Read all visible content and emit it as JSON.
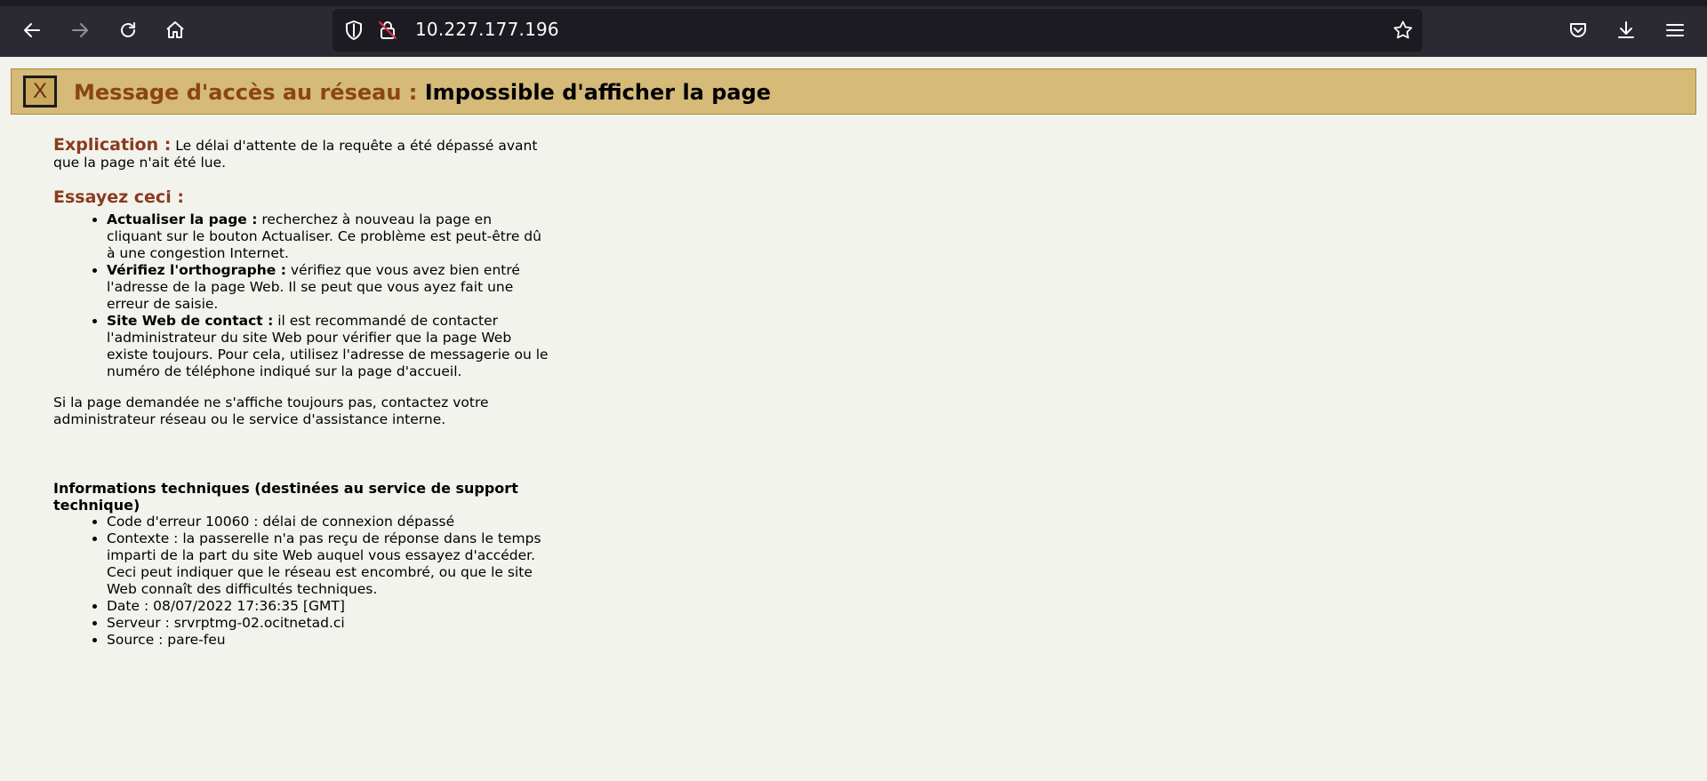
{
  "browser": {
    "url": "10.227.177.196",
    "colors": {
      "chrome": "#2b2a33",
      "urlbar": "#1c1b22",
      "icon": "#fbfbfe",
      "disabled_icon": "#8f8f9d",
      "lock_warning": "#e22850"
    },
    "icons": [
      "back-icon",
      "forward-icon",
      "reload-icon",
      "home-icon",
      "shield-icon",
      "insecure-lock-icon",
      "bookmark-star-icon",
      "pocket-icon",
      "download-icon",
      "menu-icon"
    ]
  },
  "banner": {
    "close_symbol": "X",
    "label": "Message d'accès au réseau :",
    "message": "Impossible d'afficher la page",
    "colors": {
      "background": "#d5ba78",
      "label": "#8b4513"
    }
  },
  "explanation": {
    "heading": "Explication :",
    "text": "Le délai d'attente de la requête a été dépassé avant que la page n'ait été lue."
  },
  "try_this": {
    "heading": "Essayez ceci :",
    "items": [
      {
        "title": "Actualiser la page :",
        "text": "recherchez à nouveau la page en cliquant sur le bouton Actualiser. Ce problème est peut-être dû à une congestion Internet."
      },
      {
        "title": "Vérifiez l'orthographe :",
        "text": "vérifiez que vous avez bien entré l'adresse de la page Web. Il se peut que vous ayez fait une erreur de saisie."
      },
      {
        "title": "Site Web de contact :",
        "text": "il est recommandé de contacter l'administrateur du site Web pour vérifier que la page Web existe toujours. Pour cela, utilisez l'adresse de messagerie ou le numéro de téléphone indiqué sur la page d'accueil."
      }
    ],
    "closing": "Si la page demandée ne s'affiche toujours pas, contactez votre administrateur réseau ou le service d'assistance interne."
  },
  "technical": {
    "heading": "Informations techniques (destinées au service de support technique)",
    "items": [
      "Code d'erreur 10060 : délai de connexion dépassé",
      "Contexte : la passerelle n'a pas reçu de réponse dans le temps imparti de la part du site Web auquel vous essayez d'accéder. Ceci peut indiquer que le réseau est encombré, ou que le site Web connaît des difficultés techniques.",
      "Date : 08/07/2022 17:36:35 [GMT]",
      "Serveur : srvrptmg-02.ocitnetad.ci",
      "Source : pare-feu"
    ]
  }
}
